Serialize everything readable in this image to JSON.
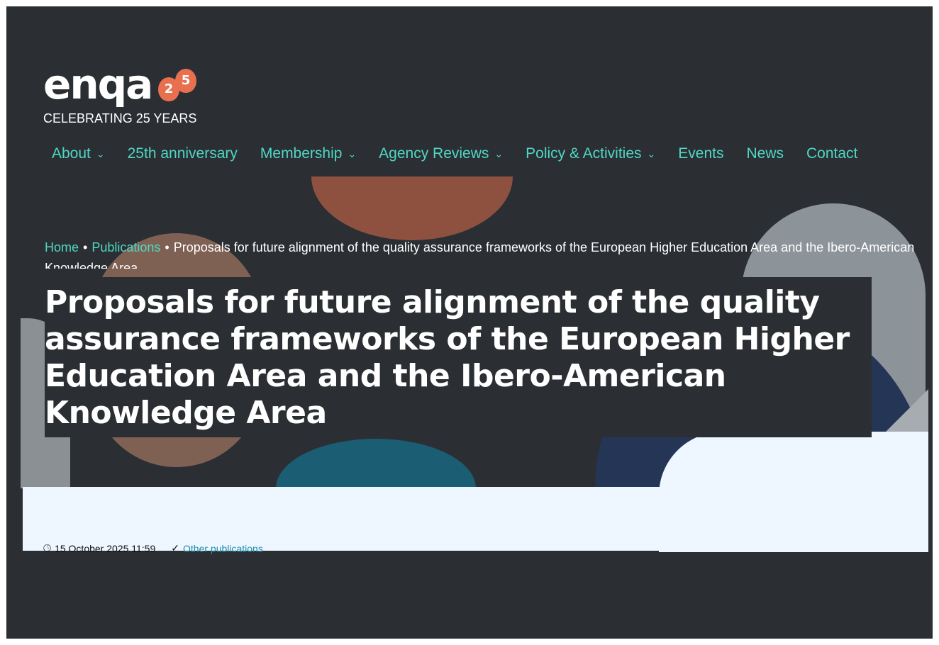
{
  "logo": {
    "wordmark": "enqa",
    "badge_digit_1": "2",
    "badge_digit_2": "5",
    "tagline": "CELEBRATING 25 YEARS"
  },
  "nav": {
    "items": [
      {
        "label": "About",
        "has_dropdown": true
      },
      {
        "label": "25th anniversary",
        "has_dropdown": false
      },
      {
        "label": "Membership",
        "has_dropdown": true
      },
      {
        "label": "Agency Reviews",
        "has_dropdown": true
      },
      {
        "label": "Policy & Activities",
        "has_dropdown": true
      },
      {
        "label": "Events",
        "has_dropdown": false
      },
      {
        "label": "News",
        "has_dropdown": false
      },
      {
        "label": "Contact",
        "has_dropdown": false
      }
    ],
    "chevron": "⌄"
  },
  "breadcrumb": {
    "home": "Home",
    "publications": "Publications",
    "separator": "•",
    "current": "Proposals for future alignment of the quality assurance frameworks of the European Higher Education Area and the Ibero-American Knowledge Area"
  },
  "page": {
    "title": "Proposals for future alignment of the quality assurance frameworks of the European Higher Education Area and the Ibero-American Knowledge Area"
  },
  "meta": {
    "date": "15 October 2025 11:59",
    "category_link": "Other publications",
    "clock_icon": "clock-icon",
    "check_icon": "check-circle-icon"
  },
  "colors": {
    "background": "#2b2f33",
    "accent": "#4fd8c4",
    "logo_balloon": "#e8704f"
  }
}
